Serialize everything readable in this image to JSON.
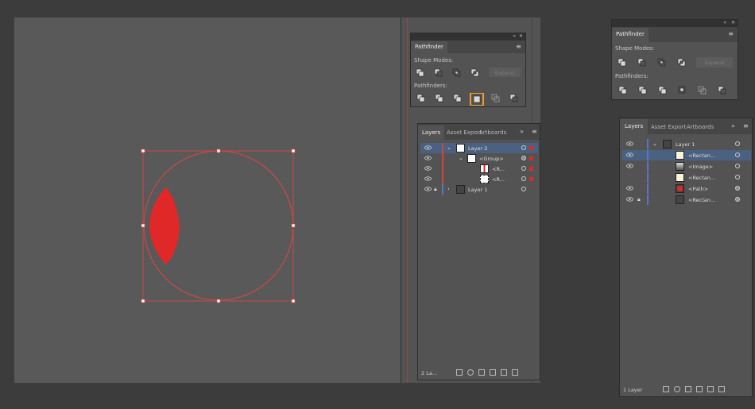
{
  "colors": {
    "accent": "#e02828",
    "selection": "#4b6182",
    "highlight": "#f0a028",
    "layer_red": "#d9413f",
    "layer_blue": "#5b74c8"
  },
  "small_pathfinder": {
    "title": "Pathfinder",
    "shape_modes_label": "Shape Modes:",
    "pathfinders_label": "Pathfinders:",
    "expand_label": "Expand",
    "shape_icons": [
      "unite-icon",
      "minus-front-icon",
      "intersect-icon",
      "exclude-icon"
    ],
    "path_icons": [
      "divide-icon",
      "trim-icon",
      "merge-icon",
      "crop-icon",
      "outline-icon",
      "minus-back-icon"
    ]
  },
  "small_layers": {
    "tabs": [
      "Layers",
      "Asset Export",
      "Artboards"
    ],
    "rows": [
      {
        "label": "Layer 2"
      },
      {
        "label": "<Group>"
      },
      {
        "label": "<R..."
      },
      {
        "label": "<R..."
      },
      {
        "label": "Layer 1"
      }
    ],
    "footer": "2 La..."
  },
  "large_pathfinder": {
    "title": "Pathfinder",
    "shape_modes_label": "Shape Modes:",
    "pathfinders_label": "Pathfinders:",
    "expand_label": "Expand"
  },
  "large_layers": {
    "tabs": [
      "Layers",
      "Asset Export",
      "Artboards"
    ],
    "rows": [
      {
        "label": "Layer 1"
      },
      {
        "label": "<Rectan..."
      },
      {
        "label": "<Image>"
      },
      {
        "label": "<Rectan..."
      },
      {
        "label": "<Path>"
      },
      {
        "label": "<Rectan..."
      }
    ],
    "footer": "1 Layer"
  }
}
